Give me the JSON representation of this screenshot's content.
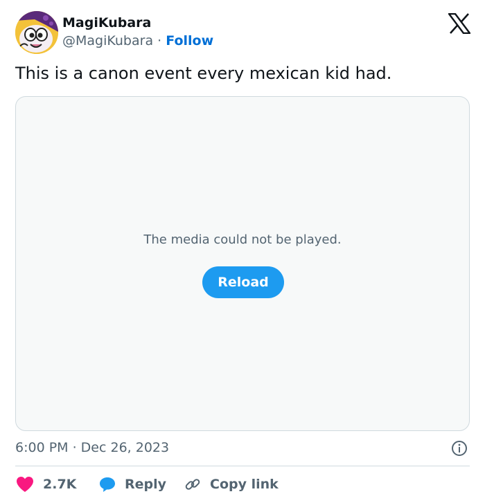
{
  "tweet": {
    "author_name": "MagiKubara",
    "handle": "@MagiKubara",
    "separator": "·",
    "follow_label": "Follow",
    "text": "This is a canon event every mexican kid had.",
    "timestamp": "6:00 PM · Dec 26, 2023"
  },
  "media": {
    "error_message": "The media could not be played.",
    "reload_label": "Reload"
  },
  "actions": {
    "like_count": "2.7K",
    "reply_label": "Reply",
    "copy_link_label": "Copy link"
  },
  "colors": {
    "accent": "#1d9bf0",
    "follow_link": "#006fd6",
    "like": "#f91880",
    "secondary_text": "#536471"
  },
  "icons": {
    "brand": "x-logo-icon",
    "info": "info-icon",
    "like": "heart-icon",
    "reply": "speech-bubble-icon",
    "copy_link": "link-icon"
  }
}
